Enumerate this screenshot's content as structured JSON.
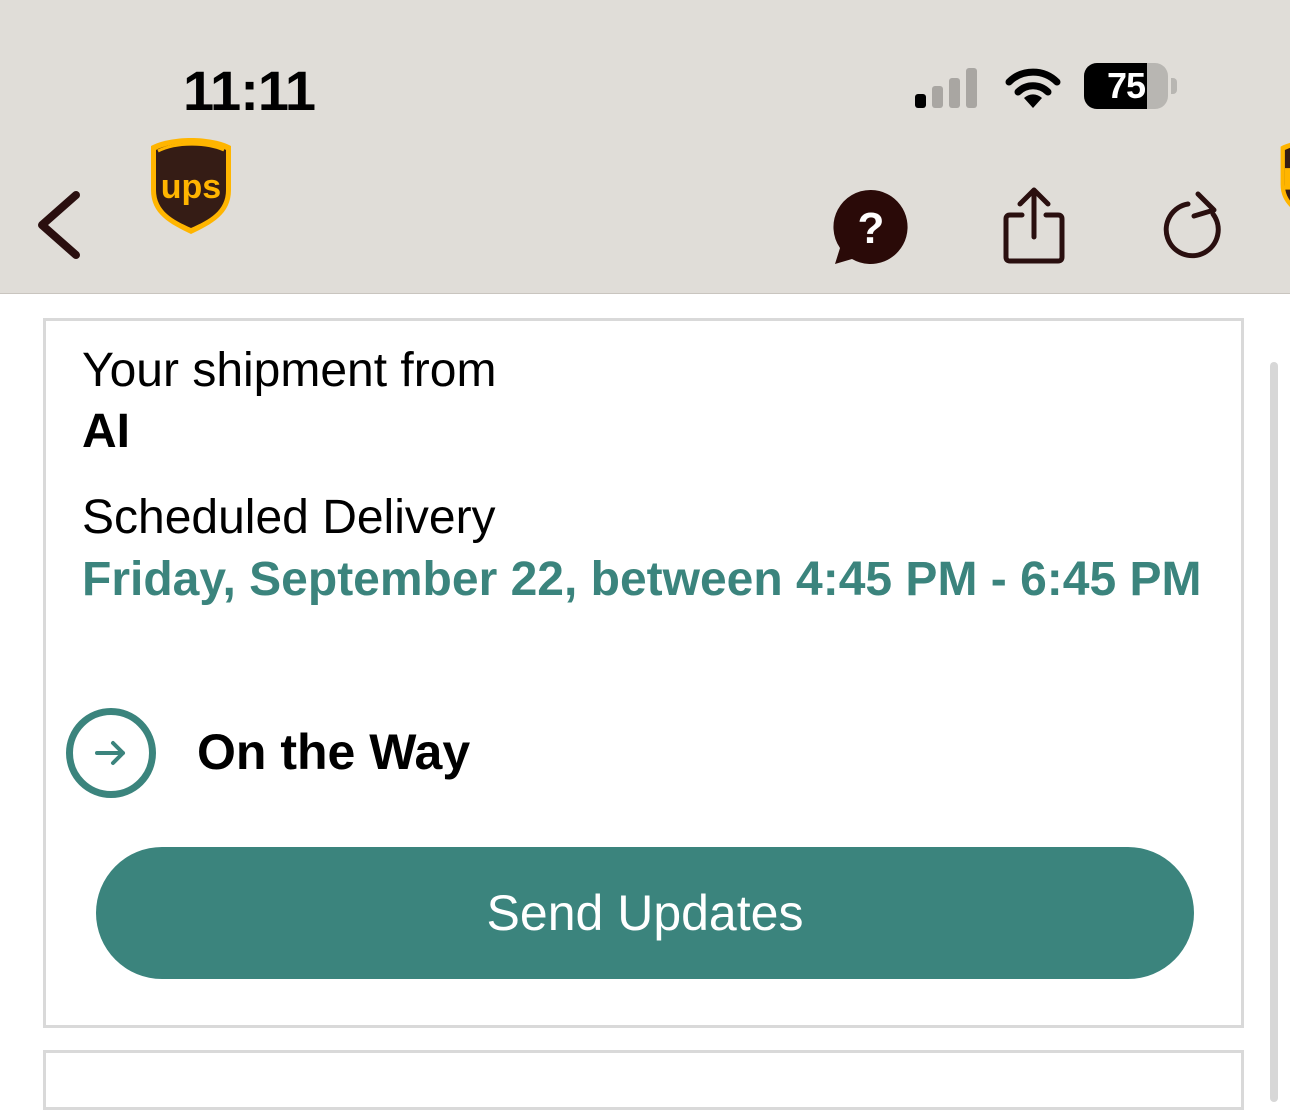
{
  "status_bar": {
    "time": "11:11",
    "battery": "75",
    "battery_level": 0.75,
    "signal_bars_active": 1,
    "signal_bars_total": 4
  },
  "header": {
    "logo_text": "ups",
    "icons": [
      "back-chevron-icon",
      "ups-logo",
      "help-chat-icon",
      "share-icon",
      "refresh-icon"
    ]
  },
  "shipment": {
    "from_label": "Your shipment from",
    "shipper": "AI",
    "scheduled_label": "Scheduled Delivery",
    "scheduled_value": "Friday, September 22, between 4:45 PM - 6:45 PM",
    "status": "On the Way",
    "button_label": "Send Updates"
  },
  "colors": {
    "header_bg": "#e0ddd8",
    "accent": "#3b847d",
    "ups_brown": "#351c15",
    "ups_gold": "#ffb500"
  }
}
